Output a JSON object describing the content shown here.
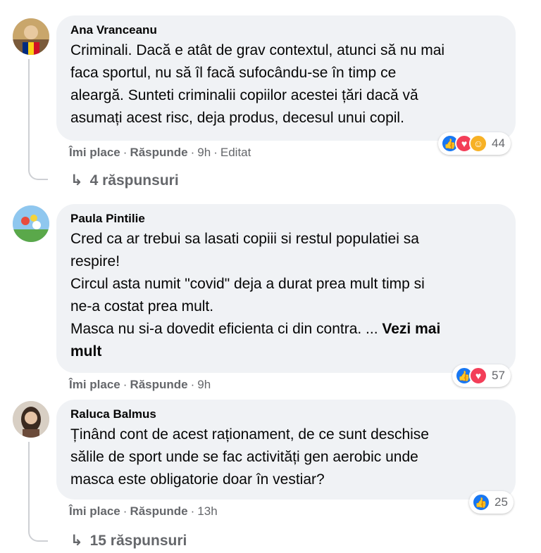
{
  "comments": [
    {
      "author": "Ana Vranceanu",
      "text": "Criminali. Dacă e atât de grav contextul, atunci să nu mai\nfaca sportul, nu să îl facă sufocându-se în timp ce\naleargă. Sunteti criminalii copiilor acestei țări dacă vă\nasumați acest risc, deja produs, decesul unui copil.",
      "like_label": "Îmi place",
      "reply_label": "Răspunde",
      "time": "9h",
      "edited": "Editat",
      "reaction_count": "44",
      "replies_label": "4 răspunsuri"
    },
    {
      "author": "Paula Pintilie",
      "text": "Cred ca ar trebui sa lasati copiii si restul populatiei sa\nrespire!\nCircul asta numit \"covid\" deja a durat prea mult timp si\nne-a costat prea mult.\nMasca nu si-a dovedit eficienta ci din contra. ... ",
      "see_more": "Vezi mai\nmult",
      "like_label": "Îmi place",
      "reply_label": "Răspunde",
      "time": "9h",
      "reaction_count": "57"
    },
    {
      "author": "Raluca Balmus",
      "text": "Ținând cont de acest raționament, de ce sunt deschise\nsălile de sport unde se fac activități gen aerobic unde\nmasca este obligatorie doar în vestiar?",
      "like_label": "Îmi place",
      "reply_label": "Răspunde",
      "time": "13h",
      "reaction_count": "25",
      "replies_label": "15 răspunsuri"
    }
  ],
  "colors": {
    "bubble": "#f0f2f5",
    "meta": "#65676b",
    "like": "#1877f2",
    "love": "#f33e58",
    "care": "#f7b125"
  }
}
